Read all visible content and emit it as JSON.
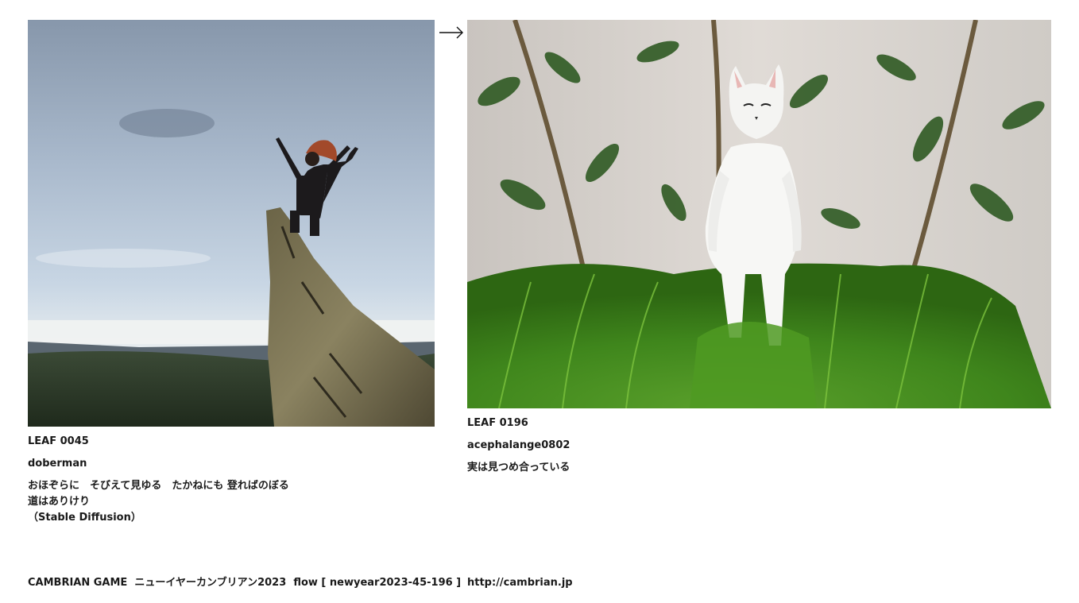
{
  "left": {
    "leaf": "LEAF 0045",
    "author": "doberman",
    "text": "おほぞらに　そびえて見ゆる　たかねにも 登ればのぼる　道はありけり\n（Stable Diffusion）",
    "image": "photo of person with arms raised on top of a rock spire"
  },
  "right": {
    "leaf": "LEAF 0196",
    "author": "acephalange0802",
    "text": "実は見つめ合っている",
    "image": "photo of white cat figurine standing in green grass"
  },
  "arrow_icon": "right-arrow-icon",
  "footer": {
    "title": "CAMBRIAN GAME",
    "subtitle": "ニューイヤーカンブリアン2023",
    "flow": "flow [ newyear2023-45-196 ]",
    "link": "http://cambrian.jp"
  }
}
